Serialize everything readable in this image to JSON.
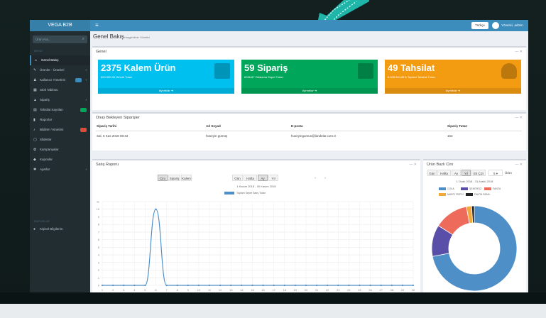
{
  "topbar": {
    "brand": "VEGA B2B",
    "menu_icon": "bars-icon",
    "lang_button": "Türkçe",
    "user_name": "Yönetici, admin"
  },
  "sidebar": {
    "search_placeholder": "Ürün Ara...",
    "header_main": "MENÜ",
    "header_reports": "RAPORLAR",
    "items": [
      {
        "label": "Genel Bakış",
        "icon": "home-icon"
      },
      {
        "label": "Ürünler - Ürünleri",
        "icon": "tag-icon"
      },
      {
        "label": "Kullanıcı Yönetimi",
        "icon": "users-icon"
      },
      {
        "label": "Stok Tablosu",
        "icon": "table-icon"
      },
      {
        "label": "Sipariş",
        "icon": "cart-icon"
      },
      {
        "label": "Tahsilat Kayıtları",
        "icon": "money-icon"
      },
      {
        "label": "Raporlar",
        "icon": "file-icon"
      },
      {
        "label": "Bildirim Yönetimi",
        "icon": "bell-icon"
      },
      {
        "label": "Sliderlar",
        "icon": "image-icon"
      },
      {
        "label": "Kampanyalar",
        "icon": "gift-icon"
      },
      {
        "label": "Kuponlar",
        "icon": "ticket-icon"
      },
      {
        "label": "Ayarlar",
        "icon": "gear-icon"
      },
      {
        "label": "Kişisel Bilgilerim",
        "icon": "user-icon"
      }
    ]
  },
  "page": {
    "title": "Genel Bakış",
    "subtitle": "Hoşgeldiniz Yönetici"
  },
  "general_box": {
    "title": "Genel",
    "cards": [
      {
        "big": "2375 Kalem Ürün",
        "small": "600.000,00 Ürünlü Tutarı",
        "foot": "Ayrıntılar",
        "color": "#00c0ef",
        "icon": "cart-icon"
      },
      {
        "big": "59 Sipariş",
        "small": "6036,87 Ortalama Sepet Tutarı",
        "foot": "Ayrıntılar",
        "color": "#00a65a",
        "icon": "bar-chart-icon"
      },
      {
        "big": "49 Tahsilat",
        "small": "6.628.944,85 ₺ Toplam Tahsilat Tutarı",
        "foot": "Ayrıntılar",
        "color": "#f39c12",
        "icon": "user-icon"
      }
    ]
  },
  "pending_box": {
    "title": "Onay Bekleyen Siparişler",
    "columns": [
      "Sipariş Tarihi",
      "Ad Soyad",
      "E-posta",
      "Sipariş Tutarı"
    ],
    "rows": [
      [
        "Sal, 6 Kas 2018 08:43",
        "hüseyin gümüş",
        "huseyingumus@landelar.com.tr",
        "153"
      ]
    ]
  },
  "sales_box": {
    "title": "Satış Raporu",
    "metric_buttons": [
      "Ciro",
      "Sipariş",
      "Kalem"
    ],
    "period_buttons": [
      "Gün",
      "Hafta",
      "Ay",
      "Yıl"
    ],
    "nav_prev": "‹",
    "nav_next": "›",
    "caption": "1 Kasım 2018 - 30 Kasım 2018",
    "legend": "Toplam Sepet Satış Tutarı"
  },
  "pie_box": {
    "title": "Ürün Bazlı Ciro",
    "period_buttons": [
      "Gün",
      "Hafta",
      "Ay",
      "Yıl",
      "Ek Çizi"
    ],
    "dropdown": "5",
    "dropdown_label": "Ürün",
    "caption": "1 Ocak 2018 - 31 Aralık 2018",
    "legend": [
      {
        "name": "COLA",
        "color": "#4f8fc8"
      },
      {
        "name": "ŞEKERÖZ",
        "color": "#5a4fa8"
      },
      {
        "name": "FANTA",
        "color": "#ee6a5a"
      },
      {
        "name": "MARTİ PEPSİ",
        "color": "#f2a93b"
      },
      {
        "name": "FANTA SIRAL",
        "color": "#222"
      }
    ]
  },
  "chart_data": [
    {
      "type": "line",
      "title": "",
      "x": [
        1,
        2,
        3,
        4,
        5,
        6,
        7,
        8,
        9,
        10,
        11,
        12,
        13,
        14,
        15,
        16,
        17,
        18,
        19,
        20,
        21,
        22,
        23,
        24,
        25,
        26,
        27,
        28,
        29,
        30
      ],
      "series": [
        {
          "name": "Toplam Sepet Satış Tutarı",
          "values": [
            0,
            0,
            0,
            0,
            0,
            10,
            0,
            0,
            0,
            0,
            0,
            0,
            0,
            0,
            0,
            0,
            0,
            0,
            0,
            0,
            0,
            0,
            0,
            0,
            0,
            0,
            0,
            0,
            0,
            0
          ]
        }
      ],
      "ylim": [
        0,
        11
      ],
      "yticks": [
        0,
        1,
        2,
        3,
        4,
        5,
        6,
        7,
        8,
        9,
        10,
        11
      ],
      "grid": true
    },
    {
      "type": "pie",
      "categories": [
        "COLA",
        "ŞEKERÖZ",
        "FANTA",
        "MARTİ PEPSİ",
        "FANTA SIRAL"
      ],
      "values": [
        72,
        12,
        13,
        2,
        1
      ],
      "donut": true
    }
  ]
}
